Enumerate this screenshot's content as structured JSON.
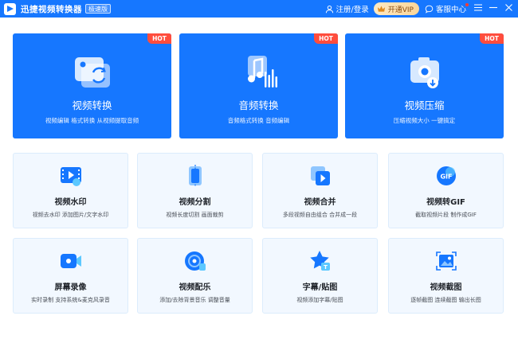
{
  "app": {
    "title": "迅捷视频转换器",
    "edition": "极速版"
  },
  "titlebar": {
    "login_label": "注册/登录",
    "vip_label": "开通VIP",
    "service_label": "客服中心",
    "icons": [
      "user-icon",
      "crown-icon",
      "chat-icon",
      "menu-icon",
      "minimize-icon",
      "close-icon"
    ]
  },
  "colors": {
    "brand": "#1677ff",
    "hot_badge": "#ff4d3d",
    "card_bg": "#f2f8ff",
    "vip_gold": "#f9d69a"
  },
  "features": [
    {
      "title": "视频转换",
      "desc": "视频编辑 格式转换 从视频提取音频",
      "badge": "HOT",
      "icon": "video-convert-icon"
    },
    {
      "title": "音频转换",
      "desc": "音频格式转换 音频编辑",
      "badge": "HOT",
      "icon": "audio-convert-icon"
    },
    {
      "title": "视频压缩",
      "desc": "压缩视频大小 一键搞定",
      "badge": "HOT",
      "icon": "video-compress-icon"
    }
  ],
  "tools": [
    {
      "title": "视频水印",
      "desc": "视频去水印 添加图片/文字水印",
      "icon": "video-watermark-icon"
    },
    {
      "title": "视频分割",
      "desc": "视频长度切割 画面裁剪",
      "icon": "video-split-icon"
    },
    {
      "title": "视频合并",
      "desc": "多段视频自由组合 合并成一段",
      "icon": "video-merge-icon"
    },
    {
      "title": "视频转GIF",
      "desc": "截取视频片段 制作成GIF",
      "icon": "gif-icon"
    },
    {
      "title": "屏幕录像",
      "desc": "实时录制 支持系统&麦克风录音",
      "icon": "screen-record-icon"
    },
    {
      "title": "视频配乐",
      "desc": "添加/去除背景音乐 调整音量",
      "icon": "music-icon"
    },
    {
      "title": "字幕/贴图",
      "desc": "视频添加字幕/贴图",
      "icon": "subtitle-sticker-icon"
    },
    {
      "title": "视频截图",
      "desc": "逐帧截图 连续截图 输出长图",
      "icon": "screenshot-icon"
    }
  ]
}
